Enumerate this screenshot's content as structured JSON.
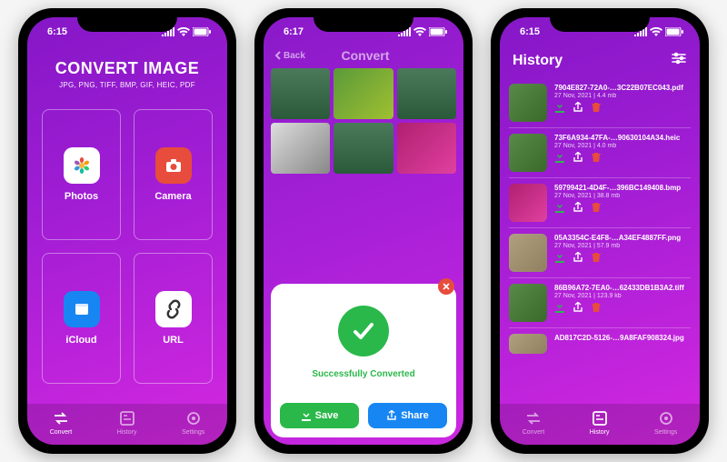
{
  "common": {
    "status_time_a": "6:15",
    "status_time_b": "6:17",
    "status_time_c": "6:15"
  },
  "screen1": {
    "title": "CONVERT IMAGE",
    "subtitle": "JPG, PNG, TIFF, BMP, GIF, HEIC, PDF",
    "tiles": {
      "photos": "Photos",
      "camera": "Camera",
      "icloud": "iCloud",
      "url": "URL"
    },
    "tabs": {
      "convert": "Convert",
      "history": "History",
      "settings": "Settings"
    }
  },
  "screen2": {
    "back": "Back",
    "nav_title": "Convert",
    "success": "Successfully Converted",
    "save": "Save",
    "share": "Share"
  },
  "screen3": {
    "title": "History",
    "items": [
      {
        "name": "7904E827-72A0-…3C22B07EC043.pdf",
        "meta": "27 Nov, 2021 | 4.4 mb"
      },
      {
        "name": "73F6A934-47FA-…90630104A34.heic",
        "meta": "27 Nov, 2021 | 4.0 mb"
      },
      {
        "name": "59799421-4D4F-…396BC149408.bmp",
        "meta": "27 Nov, 2021 | 38.8 mb"
      },
      {
        "name": "05A3354C-E4F8-…A34EF4887FF.png",
        "meta": "27 Nov, 2021 | 57.9 mb"
      },
      {
        "name": "86B96A72-7EA0-…62433DB1B3A2.tiff",
        "meta": "27 Nov, 2021 | 123.9 kb"
      },
      {
        "name": "AD817C2D-5126-…9A8FAF908324.jpg",
        "meta": ""
      }
    ],
    "tabs": {
      "convert": "Convert",
      "history": "History",
      "settings": "Settings"
    }
  }
}
